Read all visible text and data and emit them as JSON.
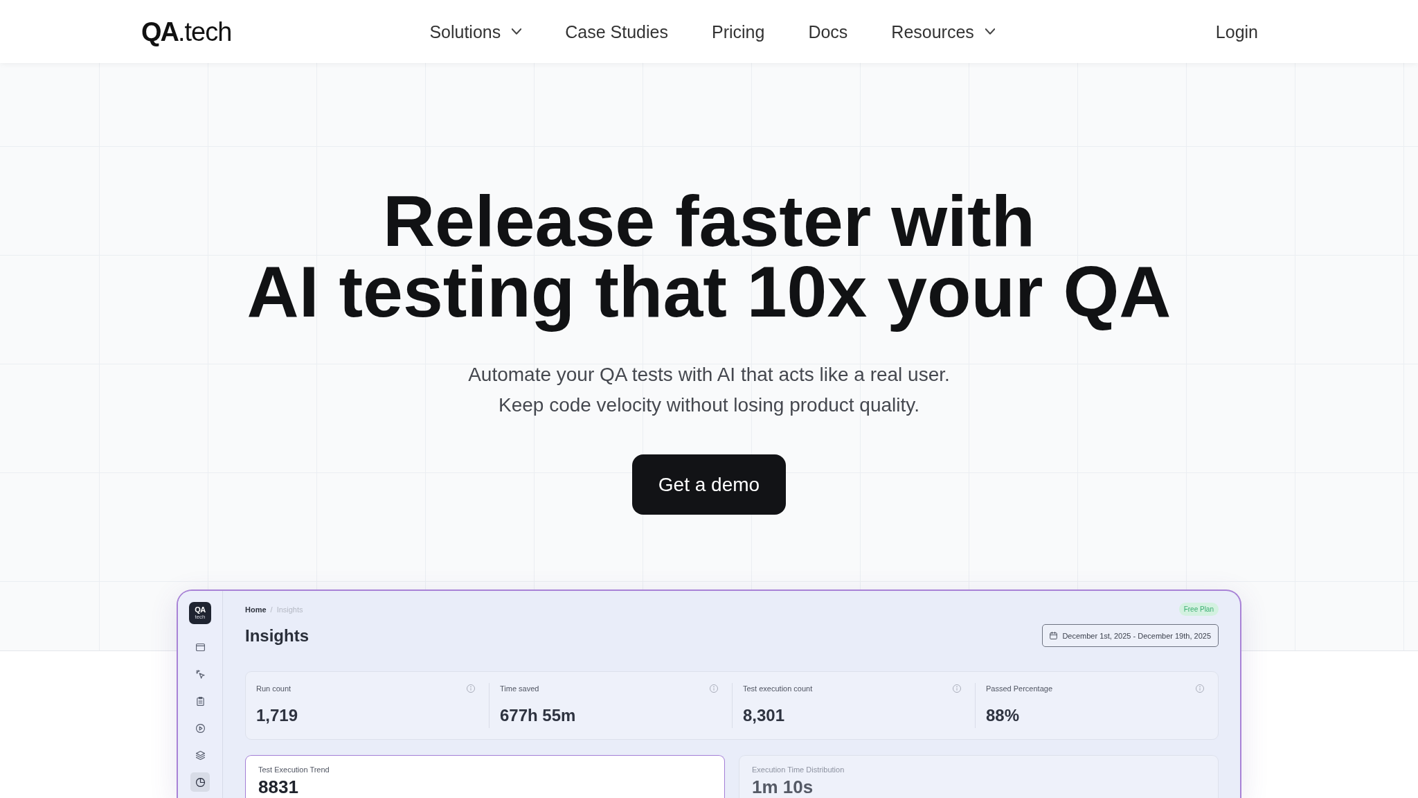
{
  "nav": {
    "logo": "**QA**.tech",
    "links": [
      {
        "label": "Solutions",
        "dropdown": true
      },
      {
        "label": "Case Studies",
        "dropdown": false
      },
      {
        "label": "Pricing",
        "dropdown": false
      },
      {
        "label": "Docs",
        "dropdown": false
      },
      {
        "label": "Resources",
        "dropdown": true
      }
    ],
    "login": "Login"
  },
  "hero": {
    "title_lines": [
      "Release faster with",
      "AI testing that 10x your QA"
    ],
    "subtitle_lines": [
      "Automate your QA tests with AI that acts like a real user.",
      "Keep code velocity without losing product quality."
    ],
    "cta": "Get a demo"
  },
  "dashboard": {
    "sidebar": {
      "logo": {
        "mark": "QA",
        "sub": "tech"
      },
      "items": [
        {
          "selected": false
        },
        {
          "selected": false
        },
        {
          "selected": false
        },
        {
          "selected": false
        },
        {
          "selected": false
        },
        {
          "selected": true
        }
      ]
    },
    "breadcrumb": {
      "separator": "/",
      "items": [
        {
          "label": "Home",
          "current": false
        },
        {
          "label": "Insights",
          "current": true
        }
      ]
    },
    "plan_badge": "Free Plan",
    "title": "Insights",
    "date_range": "December 1st, 2025 - December 19th, 2025",
    "stats": [
      {
        "label": "Run count",
        "value": "1,719"
      },
      {
        "label": "Time saved",
        "value": "677h 55m"
      },
      {
        "label": "Test execution count",
        "value": "8,301"
      },
      {
        "label": "Passed Percentage",
        "value": "88%"
      }
    ],
    "charts": [
      {
        "title": "Test Execution Trend",
        "value": "8831",
        "selected": true
      },
      {
        "title": "Execution Time Distribution",
        "value": "1m 10s",
        "selected": false
      }
    ]
  }
}
